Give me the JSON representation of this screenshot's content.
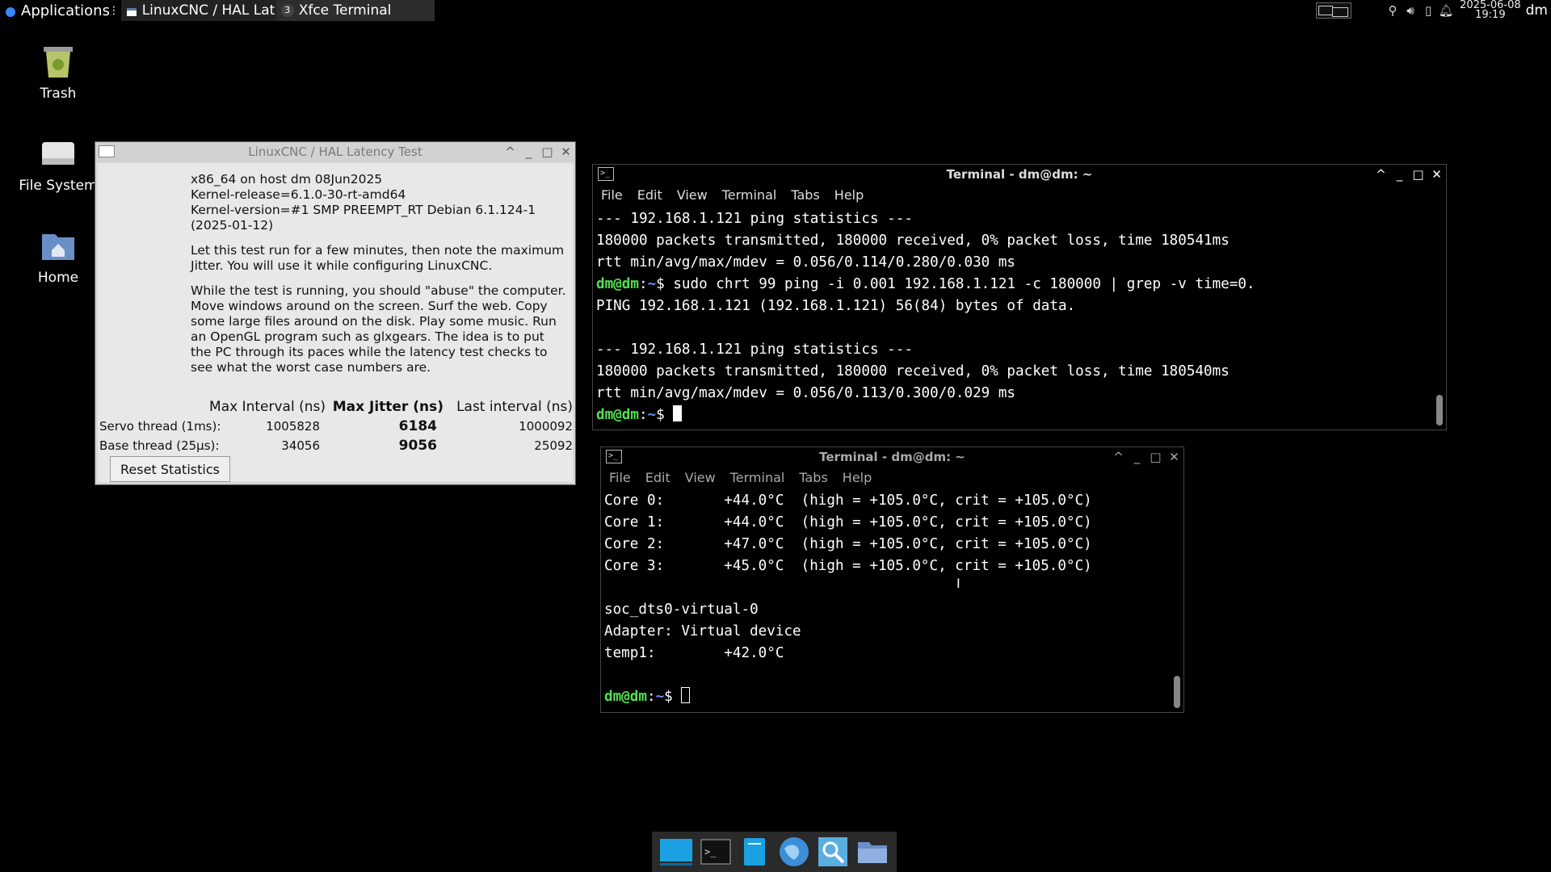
{
  "top_panel": {
    "applications_label": "Applications",
    "tasks": [
      {
        "label": "LinuxCNC / HAL Lat..."
      },
      {
        "label": "Xfce Terminal",
        "badge": "3"
      }
    ],
    "clock_date": "2025-06-08",
    "clock_time": "19:19",
    "user": "dm"
  },
  "desktop_icons": [
    {
      "label": "Trash",
      "icon": "trash-icon"
    },
    {
      "label": "File System",
      "icon": "drive-icon"
    },
    {
      "label": "Home",
      "icon": "home-folder-icon"
    }
  ],
  "latency_window": {
    "title": "LinuxCNC / HAL Latency Test",
    "info_lines": [
      "x86_64 on host dm 08Jun2025",
      "Kernel-release=6.1.0-30-rt-amd64",
      "Kernel-version=#1 SMP PREEMPT_RT Debian 6.1.124-1",
      "(2025-01-12)",
      "",
      "Let this test run for a few minutes, then note the maximum",
      "Jitter. You will use it while configuring LinuxCNC.",
      "",
      "While the test is running, you should \"abuse\" the computer.",
      "Move windows around on the screen. Surf the web. Copy",
      "some large files around on the disk. Play some music. Run",
      "an OpenGL program such as glxgears. The idea is to put",
      "the PC through its paces while the latency test checks to",
      "see what the worst case numbers are."
    ],
    "headers": {
      "max_interval": "Max Interval (ns)",
      "max_jitter": "Max Jitter (ns)",
      "last_interval": "Last interval (ns)"
    },
    "rows": [
      {
        "name": "Servo thread (1ms):",
        "max_interval": "1005828",
        "max_jitter": "6184",
        "last_interval": "1000092"
      },
      {
        "name": "Base thread (25µs):",
        "max_interval": "34056",
        "max_jitter": "9056",
        "last_interval": "25092"
      }
    ],
    "reset_label": "Reset Statistics"
  },
  "terminal1": {
    "title": "Terminal - dm@dm: ~",
    "menu": [
      "File",
      "Edit",
      "View",
      "Terminal",
      "Tabs",
      "Help"
    ],
    "lines": [
      {
        "text": "--- 192.168.1.121 ping statistics ---"
      },
      {
        "text": "180000 packets transmitted, 180000 received, 0% packet loss, time 180541ms"
      },
      {
        "text": "rtt min/avg/max/mdev = 0.056/0.114/0.280/0.030 ms"
      },
      {
        "prompt": true,
        "text": " sudo chrt 99 ping -i 0.001 192.168.1.121 -c 180000 | grep -v time=0."
      },
      {
        "text": "PING 192.168.1.121 (192.168.1.121) 56(84) bytes of data."
      },
      {
        "text": ""
      },
      {
        "text": "--- 192.168.1.121 ping statistics ---"
      },
      {
        "text": "180000 packets transmitted, 180000 received, 0% packet loss, time 180540ms"
      },
      {
        "text": "rtt min/avg/max/mdev = 0.056/0.113/0.300/0.029 ms"
      },
      {
        "prompt": true,
        "text": " ",
        "cursor": "solid"
      }
    ]
  },
  "terminal2": {
    "title": "Terminal - dm@dm: ~",
    "menu": [
      "File",
      "Edit",
      "View",
      "Terminal",
      "Tabs",
      "Help"
    ],
    "lines": [
      {
        "text": "Core 0:       +44.0°C  (high = +105.0°C, crit = +105.0°C)"
      },
      {
        "text": "Core 1:       +44.0°C  (high = +105.0°C, crit = +105.0°C)"
      },
      {
        "text": "Core 2:       +47.0°C  (high = +105.0°C, crit = +105.0°C)"
      },
      {
        "text": "Core 3:       +45.0°C  (high = +105.0°C, crit = +105.0°C)"
      },
      {
        "text": ""
      },
      {
        "text": "soc_dts0-virtual-0"
      },
      {
        "text": "Adapter: Virtual device"
      },
      {
        "text": "temp1:        +42.0°C"
      },
      {
        "text": ""
      },
      {
        "prompt": true,
        "text": " ",
        "cursor": "hollow"
      }
    ]
  },
  "prompt": {
    "user": "dm@dm",
    "sep": ":",
    "path": "~",
    "symbol": "$"
  },
  "dock": [
    {
      "icon": "desktop-icon"
    },
    {
      "icon": "terminal-icon"
    },
    {
      "icon": "file-manager-icon"
    },
    {
      "icon": "web-browser-icon"
    },
    {
      "icon": "search-icon"
    },
    {
      "icon": "folder-icon"
    }
  ],
  "colors": {
    "prompt_user": "#4fe34f",
    "prompt_path": "#6b8ff0",
    "desktop_bg": "#000000"
  }
}
